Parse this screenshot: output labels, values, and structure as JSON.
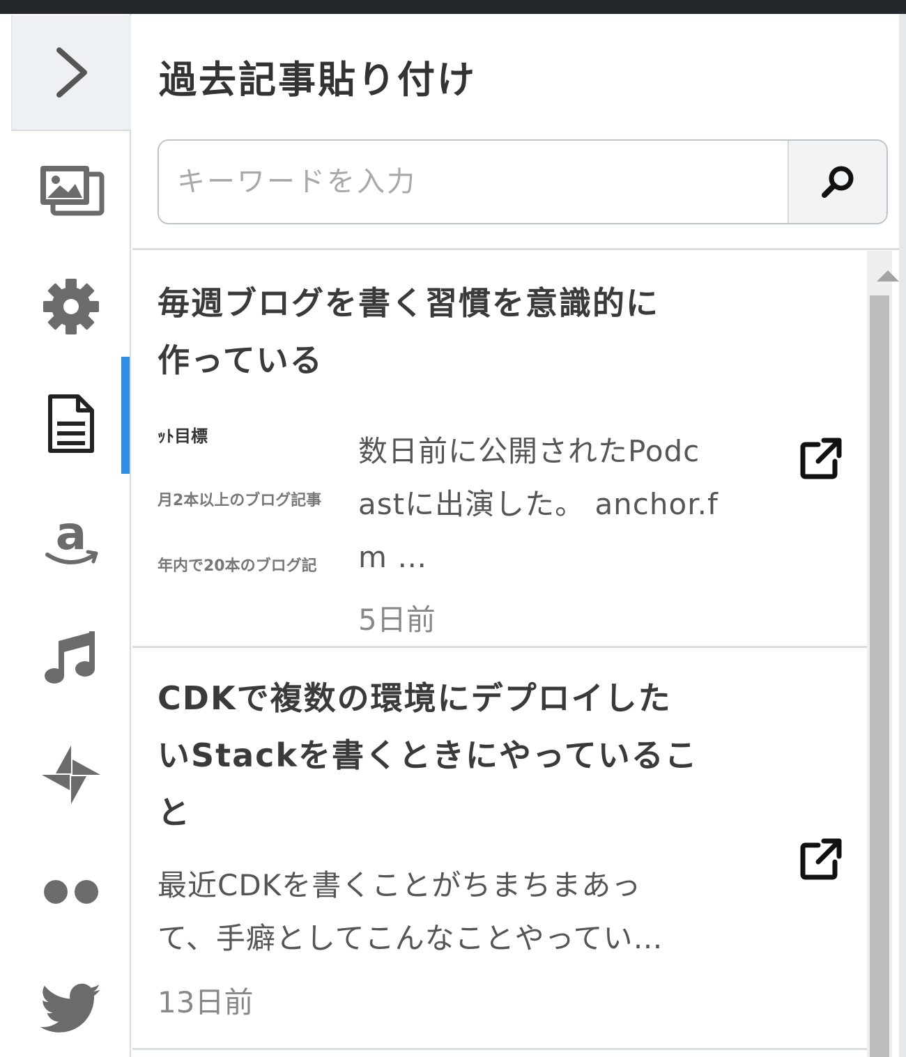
{
  "rail": {
    "toggle_icon": "chevron-right-icon",
    "items": [
      {
        "name": "image-icon"
      },
      {
        "name": "gear-icon"
      },
      {
        "name": "document-icon",
        "active": true
      },
      {
        "name": "amazon-icon"
      },
      {
        "name": "music-icon"
      },
      {
        "name": "pinwheel-icon"
      },
      {
        "name": "flickr-icon"
      },
      {
        "name": "twitter-icon"
      }
    ],
    "active_color": "#2f8de4"
  },
  "panel": {
    "title": "過去記事貼り付け",
    "search": {
      "placeholder": "キーワードを入力",
      "value": ""
    }
  },
  "entries": [
    {
      "title_line1": "毎週ブログを書く習慣を意識的に",
      "title_line2": "作っている",
      "thumbnail_lines": [
        "ｯﾄ目標",
        "月2本以上のブログ記事",
        "年内で20本のブログ記"
      ],
      "excerpt_line1": "数日前に公開されたPodc",
      "excerpt_line2": "astに出演した。 anchor.f",
      "excerpt_line3": "m …",
      "date": "5日前"
    },
    {
      "title_line1": "CDKで複数の環境にデプロイした",
      "title_line2": "いStackを書くときにやっているこ",
      "title_line3": "と",
      "excerpt_line1": "最近CDKを書くことがちまちまあっ",
      "excerpt_line2": "て、手癖としてこんなことやってい…",
      "date": "13日前"
    }
  ]
}
